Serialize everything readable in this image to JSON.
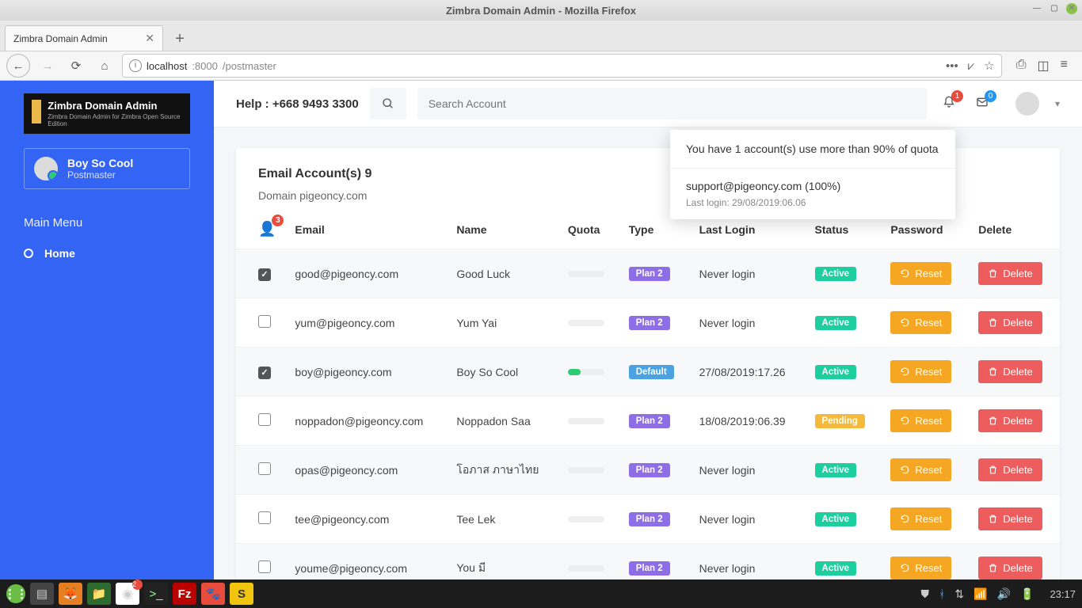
{
  "os": {
    "title": "Zimbra Domain Admin - Mozilla Firefox"
  },
  "browser": {
    "tab_title": "Zimbra Domain Admin",
    "url_host": "localhost",
    "url_port": ":8000",
    "url_path": "/postmaster"
  },
  "sidebar": {
    "logo_title": "Zimbra Domain Admin",
    "logo_sub": "Zimbra Domain Admin for Zimbra Open Source Edition",
    "user_name": "Boy So Cool",
    "user_role": "Postmaster",
    "menu_header": "Main Menu",
    "home_label": "Home"
  },
  "topbar": {
    "help_text": "Help : +668 9493 3300",
    "search_placeholder": "Search Account",
    "bell_badge": "1",
    "mail_badge": "0"
  },
  "notif": {
    "header": "You have 1 account(s) use more than 90% of quota",
    "line": "support@pigeoncy.com (100%)",
    "sub": "Last login: 29/08/2019:06.06"
  },
  "card": {
    "title": "Email Account(s) 9",
    "domain": "Domain pigeoncy.com",
    "header_badge": "3"
  },
  "columns": {
    "email": "Email",
    "name": "Name",
    "quota": "Quota",
    "type": "Type",
    "last_login": "Last Login",
    "status": "Status",
    "password": "Password",
    "delete": "Delete"
  },
  "btn_labels": {
    "reset": "Reset",
    "delete": "Delete"
  },
  "type_labels": {
    "plan2": "Plan 2",
    "default": "Default"
  },
  "status_labels": {
    "active": "Active",
    "pending": "Pending"
  },
  "rows": [
    {
      "checked": true,
      "email": "good@pigeoncy.com",
      "name": "Good Luck",
      "quota_pct": 0,
      "type": "plan2",
      "last_login": "Never login",
      "status": "active"
    },
    {
      "checked": false,
      "email": "yum@pigeoncy.com",
      "name": "Yum Yai",
      "quota_pct": 0,
      "type": "plan2",
      "last_login": "Never login",
      "status": "active"
    },
    {
      "checked": true,
      "email": "boy@pigeoncy.com",
      "name": "Boy So Cool",
      "quota_pct": 35,
      "type": "default",
      "last_login": "27/08/2019:17.26",
      "status": "active"
    },
    {
      "checked": false,
      "email": "noppadon@pigeoncy.com",
      "name": "Noppadon Saa",
      "quota_pct": 0,
      "type": "plan2",
      "last_login": "18/08/2019:06.39",
      "status": "pending"
    },
    {
      "checked": false,
      "email": "opas@pigeoncy.com",
      "name": "โอภาส ภาษาไทย",
      "quota_pct": 0,
      "type": "plan2",
      "last_login": "Never login",
      "status": "active"
    },
    {
      "checked": false,
      "email": "tee@pigeoncy.com",
      "name": "Tee Lek",
      "quota_pct": 0,
      "type": "plan2",
      "last_login": "Never login",
      "status": "active"
    },
    {
      "checked": false,
      "email": "youme@pigeoncy.com",
      "name": "You มี",
      "quota_pct": 0,
      "type": "plan2",
      "last_login": "Never login",
      "status": "active"
    }
  ],
  "taskbar": {
    "clock": "23:17",
    "chrome_badge": "2"
  }
}
